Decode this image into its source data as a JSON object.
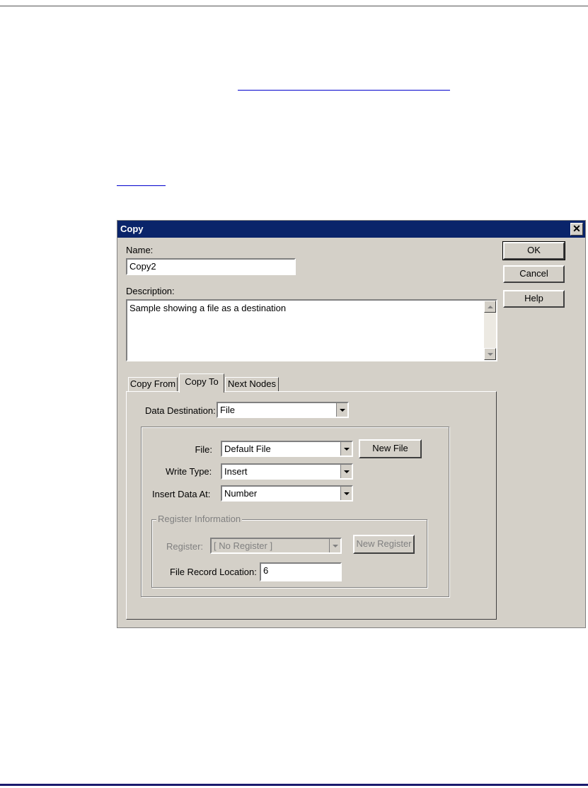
{
  "dialog": {
    "title": "Copy",
    "close_glyph": "✕",
    "name_label": "Name:",
    "name_value": "Copy2",
    "description_label": "Description:",
    "description_value": "Sample showing a file as a destination",
    "buttons": {
      "ok": "OK",
      "cancel": "Cancel",
      "help": "Help"
    },
    "tabs": [
      "Copy From",
      "Copy To",
      "Next Nodes"
    ],
    "active_tab": "Copy To",
    "copy_to": {
      "data_destination_label": "Data Destination:",
      "data_destination_value": "File",
      "file_label": "File:",
      "file_value": "Default File",
      "new_file_button": "New File",
      "write_type_label": "Write Type:",
      "write_type_value": "Insert",
      "insert_at_label": "Insert Data At:",
      "insert_at_value": "Number",
      "register_group_title": "Register Information",
      "register_label": "Register:",
      "register_value": "[ No Register ]",
      "new_register_button": "New Register",
      "file_record_label": "File Record Location:",
      "file_record_value": "6"
    }
  },
  "icons": {
    "close": "close-icon",
    "combo": "chevron-down-icon",
    "scroll_up": "scroll-up-icon",
    "scroll_down": "scroll-down-icon"
  },
  "colors": {
    "titlebar": "#0a246a",
    "dialog_face": "#d4d0c8",
    "link_underline": "#0000cc"
  }
}
